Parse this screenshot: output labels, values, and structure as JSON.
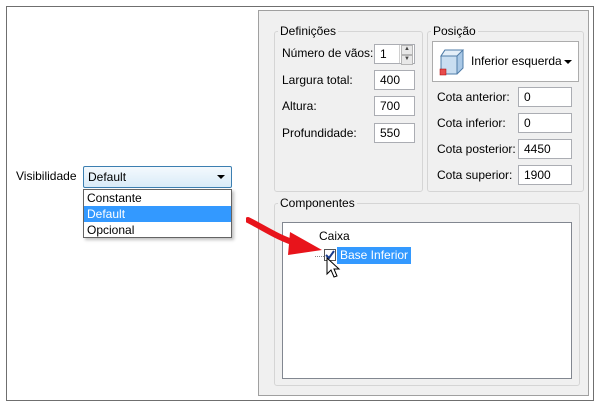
{
  "visibility": {
    "label": "Visibilidade",
    "selected": "Default",
    "options": [
      {
        "label": "Constante",
        "selected": false
      },
      {
        "label": "Default",
        "selected": true
      },
      {
        "label": "Opcional",
        "selected": false
      }
    ]
  },
  "definicoes": {
    "title": "Definições",
    "fields": [
      {
        "label": "Número de vãos:",
        "value": "1"
      },
      {
        "label": "Largura total:",
        "value": "400"
      },
      {
        "label": "Altura:",
        "value": "700"
      },
      {
        "label": "Profundidade:",
        "value": "550"
      }
    ]
  },
  "posicao": {
    "title": "Posição",
    "selected": "Inferior esquerda",
    "icon": "cube-position-icon",
    "fields": [
      {
        "label": "Cota anterior:",
        "value": "0"
      },
      {
        "label": "Cota inferior:",
        "value": "0"
      },
      {
        "label": "Cota posterior:",
        "value": "4450"
      },
      {
        "label": "Cota superior:",
        "value": "1900"
      }
    ]
  },
  "componentes": {
    "title": "Componentes",
    "tree": [
      {
        "label": "Caixa",
        "children": [
          {
            "label": "Base Inferior",
            "checked": true,
            "selected": true
          }
        ]
      }
    ]
  },
  "colors": {
    "selection": "#3399ff",
    "annotation_arrow": "#e8141b"
  }
}
